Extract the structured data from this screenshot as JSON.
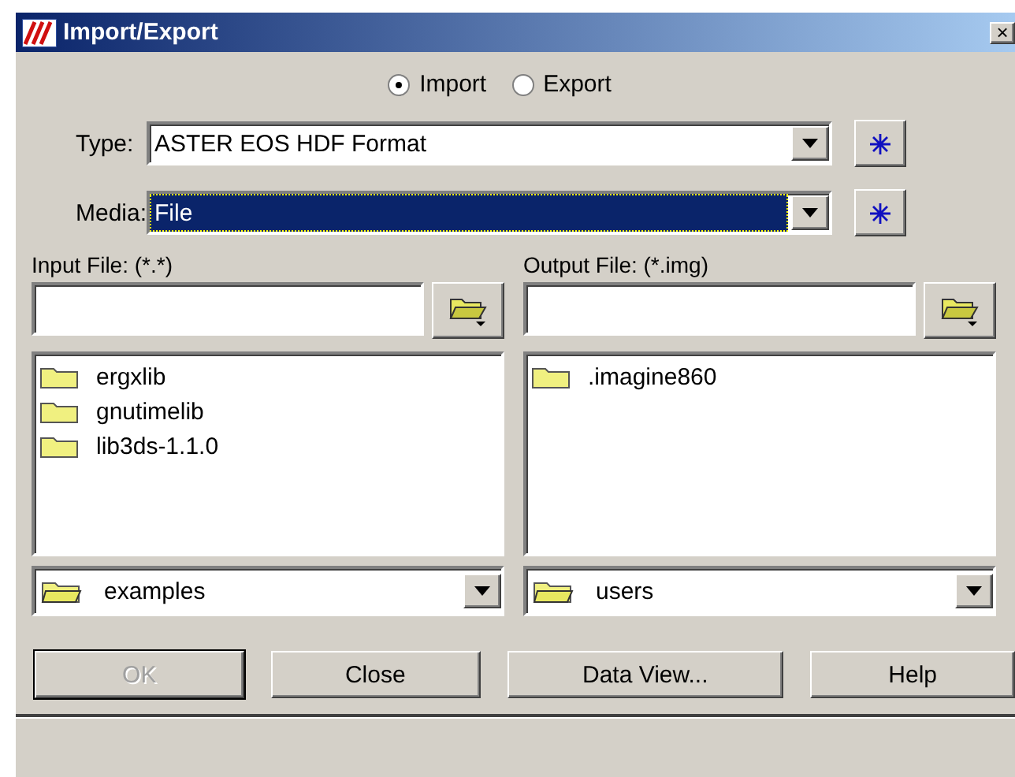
{
  "window": {
    "title": "Import/Export",
    "close": "×"
  },
  "mode": [
    {
      "label": "Import",
      "selected": true
    },
    {
      "label": "Export",
      "selected": false
    }
  ],
  "selectors": [
    {
      "label": "Type:",
      "value": "ASTER EOS HDF Format",
      "highlighted": false
    },
    {
      "label": "Media:",
      "value": "File",
      "highlighted": true
    }
  ],
  "panes": [
    {
      "label": "Input File: (*.*)",
      "files": [
        "ergxlib",
        "gnutimelib",
        "lib3ds-1.1.0"
      ],
      "directory": "examples"
    },
    {
      "label": "Output File: (*.img)",
      "files": [
        ".imagine860"
      ],
      "directory": "users"
    }
  ],
  "buttons": [
    {
      "label": "OK",
      "disabled": true
    },
    {
      "label": "Close",
      "disabled": false
    },
    {
      "label": "Data View...",
      "disabled": false
    },
    {
      "label": "Help",
      "disabled": false
    }
  ]
}
